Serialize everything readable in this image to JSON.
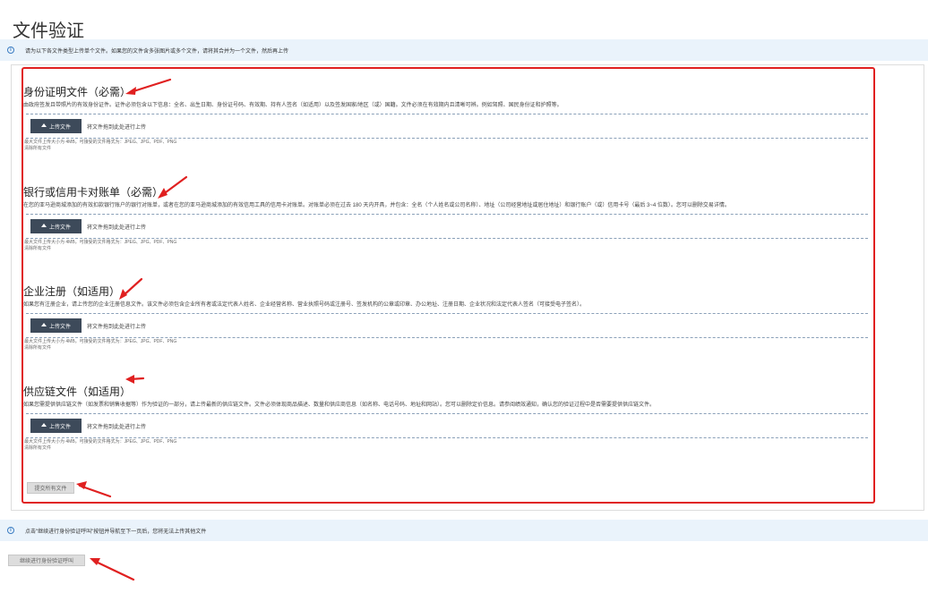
{
  "page": {
    "title": "文件验证"
  },
  "notice_top": {
    "text": "请为以下各文件类型上传单个文件。如果您的文件含多张图片或多个文件，请将其合并为一个文件，然后再上传"
  },
  "upload_common": {
    "button_label": "上传文件",
    "drop_text": "将文件拖到此处进行上传",
    "hint": "最大文件上传大小为 4MB，可接受的文件格式为：JPEG、JPG、PDF、PNG",
    "clear_label": "清除所有文件"
  },
  "sections": [
    {
      "title": "身份证明文件（必需）",
      "desc": "由政府签发且带照片的有效身份证件。证件必须包含以下信息：全名、出生日期、身份证号码、有效期、持有人签名（如适用）以及签发国家/地区（或）国籍。文件必须在有效期内且清晰可辨。例如驾照、国民身份证和护照等。"
    },
    {
      "title": "银行或信用卡对账单（必需）",
      "desc": "在您的亚马逊商城添加的有效扣款银行账户的银行对账单，或者在您的亚马逊商城添加的有效信用工具的信用卡对账单。对账单必须在过去 180 天内开具，并包含：全名（个人姓名或公司名称）、地址（公司经营地址或居住地址）和银行账户（或）信用卡号（最后 3~4 位数）。您可以删除交易详情。"
    },
    {
      "title": "企业注册（如适用）",
      "desc": "如果您有注册企业，请上传您的企业注册信息文件。该文件必须包含企业所有者或法定代表人姓名、企业经营名称、营业执照号码或注册号、签发机构的公章或印章、办公地址、注册日期、企业状况和法定代表人签名（可接受电子签名）。"
    },
    {
      "title": "供应链文件（如适用）",
      "desc": "如果您需提供供应链文件（如发票和销售收据等）作为验证的一部分，请上传最新的供应链文件。文件必须体现商品描述、数量和供应商信息（如名称、电话号码、地址和网站）。您可以删除定价信息。请参阅绩效通知，确认您的验证过程中是否需要提供供应链文件。"
    }
  ],
  "actions": {
    "submit_label": "提交所有文件",
    "continue_label": "继续进行身份验证呼叫"
  },
  "notice_bottom": {
    "text": "点击\"继续进行身份验证呼叫\"按钮并导航至下一页后，您将无法上传其他文件"
  },
  "colors": {
    "annotation_red": "#e02020",
    "info_bg": "#eaf3fb",
    "button_dark": "#3d4a5a"
  }
}
